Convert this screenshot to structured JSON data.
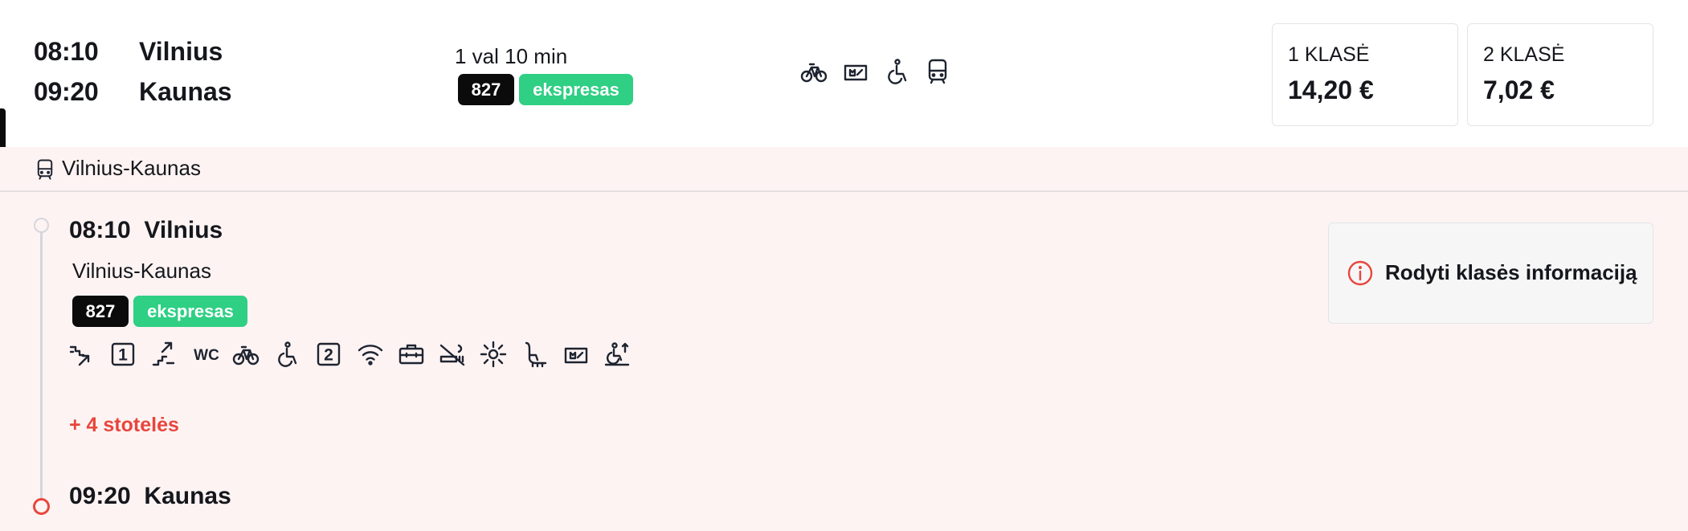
{
  "journey": {
    "departure_time": "08:10",
    "departure_city": "Vilnius",
    "arrival_time": "09:20",
    "arrival_city": "Kaunas",
    "duration": "1 val 10 min",
    "train_number": "827",
    "train_type": "ekspresas",
    "amenity_icons": [
      "bicycle-icon",
      "pet-icon",
      "wheelchair-icon",
      "train-icon"
    ]
  },
  "prices": [
    {
      "class_label": "1 KLASĖ",
      "price": "14,20 €"
    },
    {
      "class_label": "2 KLASĖ",
      "price": "7,02 €"
    }
  ],
  "details": {
    "route_name": "Vilnius-Kaunas",
    "route_icon": "train-icon",
    "start_stop": {
      "time": "08:10",
      "city": "Vilnius"
    },
    "end_stop": {
      "time": "09:20",
      "city": "Kaunas"
    },
    "sub_route": "Vilnius-Kaunas",
    "train_number": "827",
    "train_type": "ekspresas",
    "feature_icons": [
      "stairs-down-icon",
      "first-class-icon",
      "stairs-up-icon",
      "wc-icon",
      "bicycle-icon",
      "wheelchair-icon",
      "second-class-icon",
      "wifi-icon",
      "luggage-icon",
      "no-smoking-icon",
      "air-conditioning-icon",
      "stroller-icon",
      "pet-icon",
      "wheelchair-lift-icon"
    ],
    "wc_text": "WC",
    "first_class_mark": "1",
    "second_class_mark": "2",
    "more_stops": "+ 4 stotelės",
    "class_info_button": "Rodyti klasės informaciją"
  },
  "colors": {
    "accent_red": "#e8463c",
    "express_green": "#2fcf84",
    "number_badge": "#0b0b0b",
    "panel_bg": "#fdf3f3"
  }
}
